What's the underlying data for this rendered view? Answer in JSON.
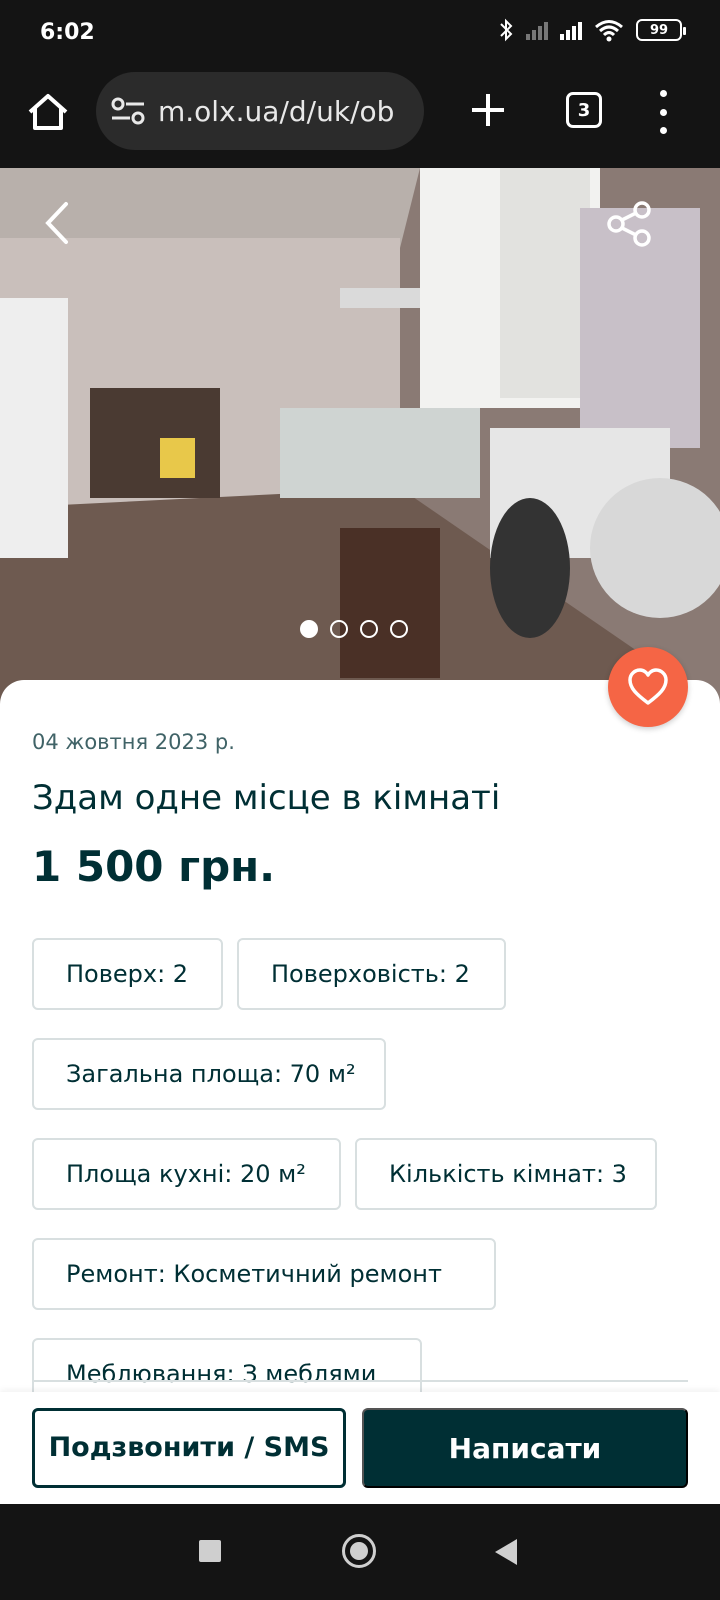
{
  "status_bar": {
    "time": "6:02",
    "battery": "99"
  },
  "browser": {
    "url": "m.olx.ua/d/uk/ob",
    "tab_count": "3"
  },
  "gallery": {
    "image_count": 4,
    "active_index": 0
  },
  "listing": {
    "date": "04 жовтня 2023 р.",
    "title": "Здам одне місце в кімнаті",
    "price": "1 500 грн.",
    "params": [
      "Поверх: 2",
      "Поверховість: 2",
      "Загальна площа: 70 м²",
      "Площа кухні: 20 м²",
      "Кількість кімнат: 3",
      "Ремонт: Косметичний ремонт",
      "Меблювання: З меблями"
    ]
  },
  "actions": {
    "call_label": "Подзвонити / SMS",
    "write_label": "Написати"
  },
  "colors": {
    "primary": "#002f34",
    "favorite": "#f56545",
    "system_bar": "#141414"
  }
}
